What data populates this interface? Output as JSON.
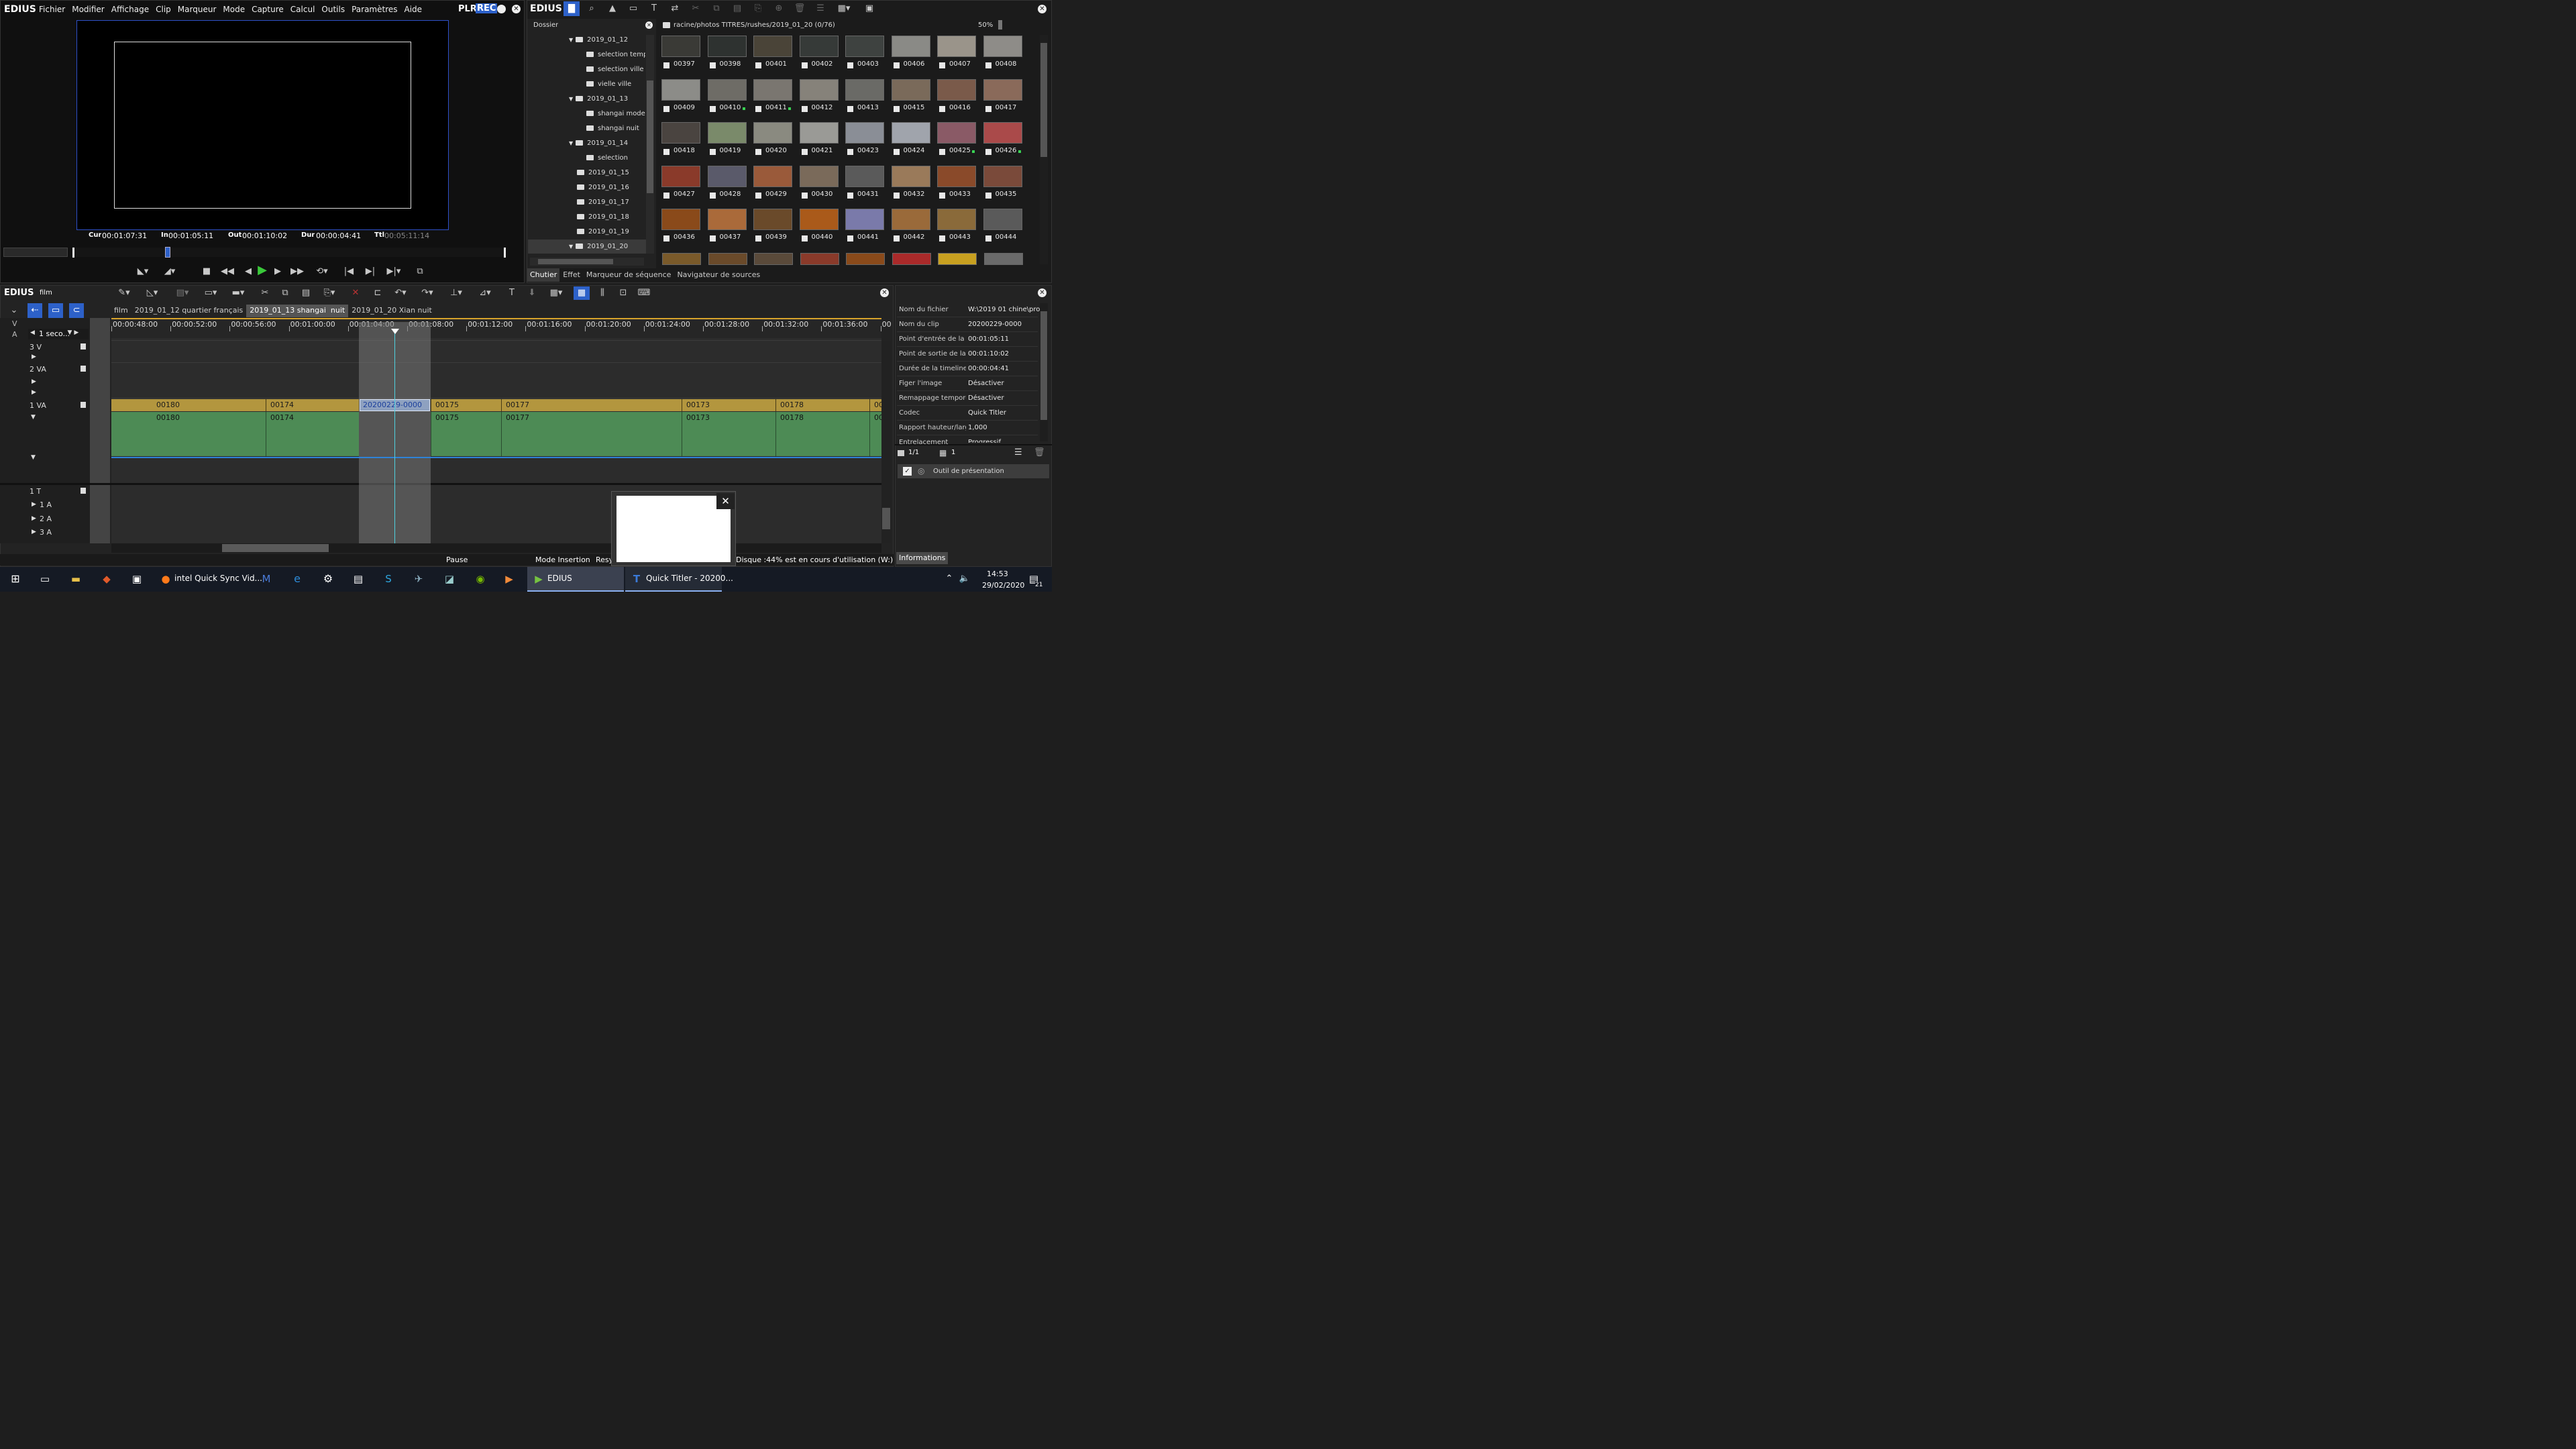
{
  "app": {
    "logo": "EDIUS"
  },
  "menu": [
    "Fichier",
    "Modifier",
    "Affichage",
    "Clip",
    "Marqueur",
    "Mode",
    "Capture",
    "Calcul",
    "Outils",
    "Paramètres",
    "Aide"
  ],
  "player": {
    "plr": "PLR",
    "rec": "REC",
    "cur_label": "Cur",
    "cur": "00:01:07:31",
    "in_label": "In",
    "in": "00:01:05:11",
    "out_label": "Out",
    "out": "00:01:10:02",
    "dur_label": "Dur",
    "dur": "00:00:04:41",
    "ttl_label": "Ttl",
    "ttl": "00:05:11:14"
  },
  "bin": {
    "logo": "EDIUS",
    "folder_header": "Dossier",
    "path": "racine/photos TITRES/rushes/2019_01_20 (0/76)",
    "zoom": "50%",
    "tree": [
      {
        "label": "2019_01_12",
        "indent": 0,
        "expanded": true
      },
      {
        "label": "selection temple",
        "indent": 1
      },
      {
        "label": "selection ville moderne",
        "indent": 1
      },
      {
        "label": "vielle ville",
        "indent": 1
      },
      {
        "label": "2019_01_13",
        "indent": 0,
        "expanded": true
      },
      {
        "label": "shangai moderne",
        "indent": 1
      },
      {
        "label": "shangai nuit",
        "indent": 1
      },
      {
        "label": "2019_01_14",
        "indent": 0,
        "expanded": true
      },
      {
        "label": "selection",
        "indent": 1
      },
      {
        "label": "2019_01_15",
        "indent": 0
      },
      {
        "label": "2019_01_16",
        "indent": 0
      },
      {
        "label": "2019_01_17",
        "indent": 0
      },
      {
        "label": "2019_01_18",
        "indent": 0
      },
      {
        "label": "2019_01_19",
        "indent": 0
      },
      {
        "label": "2019_01_20",
        "indent": 0,
        "expanded": true,
        "selected": true
      }
    ],
    "clips": [
      {
        "id": "00397",
        "color": "#3a3a36"
      },
      {
        "id": "00398",
        "color": "#2e3230"
      },
      {
        "id": "00401",
        "color": "#4a4438"
      },
      {
        "id": "00402",
        "color": "#363a38"
      },
      {
        "id": "00403",
        "color": "#3e4240"
      },
      {
        "id": "00406",
        "color": "#8a8a86"
      },
      {
        "id": "00407",
        "color": "#9a948a"
      },
      {
        "id": "00408",
        "color": "#8e8c88"
      },
      {
        "id": "00409",
        "color": "#8c8c88"
      },
      {
        "id": "00410",
        "color": "#6e6c66",
        "dot": true
      },
      {
        "id": "00411",
        "color": "#7a7670",
        "dot": true
      },
      {
        "id": "00412",
        "color": "#86827a"
      },
      {
        "id": "00413",
        "color": "#6a6a66"
      },
      {
        "id": "00415",
        "color": "#7a6a5a"
      },
      {
        "id": "00416",
        "color": "#7a5a4a"
      },
      {
        "id": "00417",
        "color": "#8a6a5a"
      },
      {
        "id": "00418",
        "color": "#4a4440"
      },
      {
        "id": "00419",
        "color": "#7a8a6a"
      },
      {
        "id": "00420",
        "color": "#8a8a80"
      },
      {
        "id": "00421",
        "color": "#9a9a96"
      },
      {
        "id": "00423",
        "color": "#8a8e96"
      },
      {
        "id": "00424",
        "color": "#a0a4ac"
      },
      {
        "id": "00425",
        "color": "#8a5a66",
        "dot": true
      },
      {
        "id": "00426",
        "color": "#aa4a4a",
        "dot": true
      },
      {
        "id": "00427",
        "color": "#8a3a2a"
      },
      {
        "id": "00428",
        "color": "#5a5a6a"
      },
      {
        "id": "00429",
        "color": "#9a5a3a"
      },
      {
        "id": "00430",
        "color": "#7a6a5a"
      },
      {
        "id": "00431",
        "color": "#5a5a5a"
      },
      {
        "id": "00432",
        "color": "#9a7a5a"
      },
      {
        "id": "00433",
        "color": "#8a4a2a"
      },
      {
        "id": "00435",
        "color": "#7a4a3a"
      },
      {
        "id": "00436",
        "color": "#8a4a1a"
      },
      {
        "id": "00437",
        "color": "#aa6a3a"
      },
      {
        "id": "00439",
        "color": "#6a4a2a"
      },
      {
        "id": "00440",
        "color": "#aa5a1a"
      },
      {
        "id": "00441",
        "color": "#7a7aaa"
      },
      {
        "id": "00442",
        "color": "#9a6a3a"
      },
      {
        "id": "00443",
        "color": "#8a6a3a"
      },
      {
        "id": "00444",
        "color": "#5a5a5a"
      }
    ],
    "tabs": [
      "Chutier",
      "Effet",
      "Marqueur de séquence",
      "Navigateur de sources"
    ]
  },
  "timeline": {
    "logo": "EDIUS",
    "project": "film",
    "seq_tabs": [
      "film",
      "2019_01_12 quartier français",
      "2019_01_13 shangai  nuit",
      "2019_01_20 Xian nuit"
    ],
    "scale": "1 seco...",
    "ruler": [
      "00:00:48:00",
      "00:00:52:00",
      "00:00:56:00",
      "00:01:00:00",
      "00:01:04:00",
      "00:01:08:00",
      "00:01:12:00",
      "00:01:16:00",
      "00:01:20:00",
      "00:01:24:00",
      "00:01:28:00",
      "00:01:32:00",
      "00:01:36:00",
      "00"
    ],
    "tracks": {
      "v": "V",
      "a": "A",
      "t3v": "3 V",
      "t2va": "2 VA",
      "t1va": "1 VA",
      "t1t": "1 T",
      "a1": "1 A",
      "a2": "2 A",
      "a3": "3 A"
    },
    "clips": [
      "00180",
      "00174",
      "20200229-0000",
      "00175",
      "00177",
      "00173",
      "00178",
      "00"
    ],
    "audio_clips": [
      "00180",
      "00174",
      "00175",
      "00177",
      "00173",
      "00178",
      "00"
    ],
    "status": {
      "pause": "Pause",
      "mode": "Mode Insertion",
      "resync": "Resy",
      "disk": "Disque :44% est en cours d'utilisation (W:)"
    }
  },
  "info": {
    "props": [
      {
        "k": "Nom du fichier",
        "v": "W:\\2019 01 chine\\pro..."
      },
      {
        "k": "Nom du clip",
        "v": "20200229-0000"
      },
      {
        "k": "Point d'entrée de la ti...",
        "v": "00:01:05:11"
      },
      {
        "k": "Point de sortie de la ti...",
        "v": "00:01:10:02"
      },
      {
        "k": "Durée de la timeline",
        "v": "00:00:04:41"
      },
      {
        "k": "Figer l'image",
        "v": "Désactiver"
      },
      {
        "k": "Remappage temporel",
        "v": "Désactiver"
      },
      {
        "k": "Codec",
        "v": "Quick Titler"
      },
      {
        "k": "Rapport hauteur/larg...",
        "v": "1,000"
      },
      {
        "k": "Entrelacement",
        "v": "Progressif"
      }
    ],
    "page": "1/1",
    "count": "1",
    "effect": "Outil de présentation",
    "tab": "Informations"
  },
  "taskbar": {
    "items": [
      "intel Quick Sync Vid...",
      "EDIUS",
      "Quick Titler - 20200..."
    ],
    "time": "14:53",
    "date": "29/02/2020",
    "notif": "21"
  }
}
